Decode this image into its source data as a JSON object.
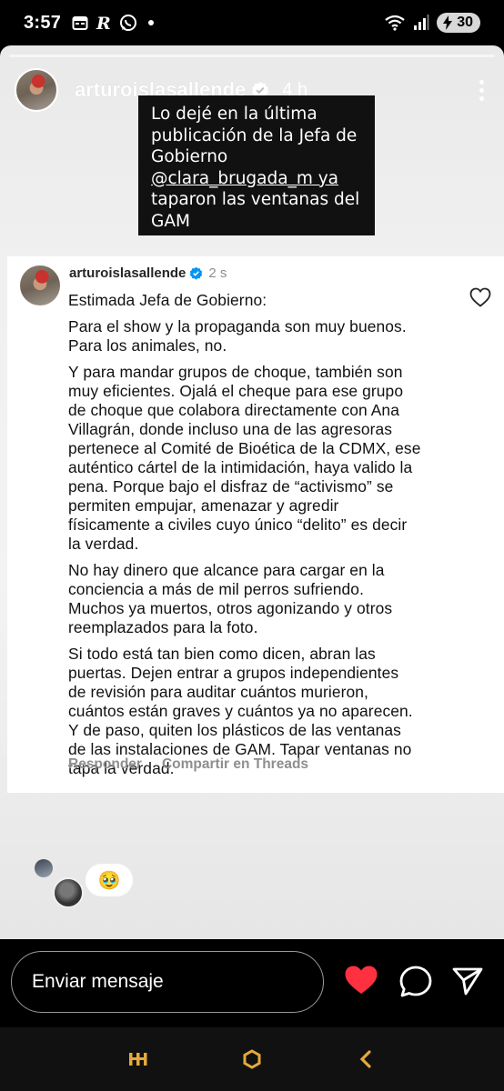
{
  "status_bar": {
    "time": "3:57",
    "battery": "30",
    "left_icons": [
      "calendar-icon",
      "r-app-icon",
      "whatsapp-icon"
    ],
    "right_icons": [
      "wifi-icon",
      "signal-icon"
    ]
  },
  "story": {
    "progress": 0.0,
    "username": "arturoislasallende",
    "time": "4 h",
    "overlay_lines": [
      "Lo dejé en la última",
      "publicación de la Jefa de",
      "Gobierno",
      "@clara_brugada_m ya",
      "taparon las ventanas del",
      "GAM"
    ]
  },
  "comment": {
    "username": "arturoislasallende",
    "time": "2 s",
    "greeting": "Estimada Jefa de Gobierno:",
    "paragraphs": [
      [
        "Para el show y la propaganda son muy buenos.",
        "Para los animales, no."
      ],
      [
        "Y para mandar grupos de choque, también son",
        "muy eficientes. Ojalá el cheque para ese grupo",
        "de choque que colabora directamente con Ana",
        "Villagrán, donde incluso una de las agresoras",
        "pertenece al Comité de Bioética de la CDMX, ese",
        "auténtico cártel de la intimidación, haya valido la",
        "pena. Porque bajo el disfraz de “activismo” se",
        "permiten empujar, amenazar y agredir",
        "físicamente a civiles cuyo único “delito” es decir",
        "la verdad."
      ],
      [
        "No hay dinero que alcance para cargar en la",
        "conciencia a más de mil perros sufriendo.",
        "Muchos ya muertos, otros agonizando y otros",
        "reemplazados para la foto."
      ],
      [
        "Si todo está tan bien como dicen, abran las",
        "puertas. Dejen entrar a grupos independientes",
        "de revisión para auditar cuántos murieron,",
        "cuántos están graves y cuántos ya no aparecen.",
        "Y de paso, quiten los plásticos de las ventanas",
        "de las instalaciones de GAM. Tapar ventanas no",
        "tapa la verdad."
      ]
    ],
    "reply_label": "Responder",
    "share_label": "Compartir en Threads"
  },
  "reaction": {
    "emoji": "🥹"
  },
  "message_bar": {
    "placeholder": "Enviar mensaje",
    "like_color": "#ff3040"
  }
}
